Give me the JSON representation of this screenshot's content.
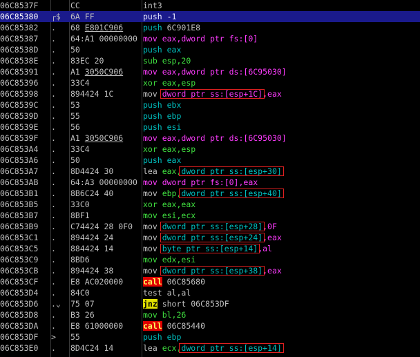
{
  "rows": [
    {
      "addr": "06C8537F",
      "mark": "",
      "hex": "CC",
      "hex_u": "",
      "hex_post": "",
      "asm": [
        {
          "m": "int3",
          "c": "t-m"
        }
      ]
    },
    {
      "addr": "06C85380",
      "mark": "┌$",
      "hex": "6A FF",
      "hex_u": "",
      "hex_post": "",
      "selected": true,
      "asm": [
        {
          "m": "push",
          "c": "t-m"
        },
        {
          "m": " -1",
          "c": "t-w"
        }
      ]
    },
    {
      "addr": "06C85382",
      "mark": ".",
      "hex": "68 ",
      "hex_u": "E801C906",
      "hex_post": "",
      "asm": [
        {
          "m": "push",
          "c": "t-mc"
        },
        {
          "m": " 6C901E8",
          "c": "t-w"
        }
      ]
    },
    {
      "addr": "06C85387",
      "mark": ".",
      "hex": "64:A1 00000000",
      "hex_u": "",
      "hex_post": "",
      "asm": [
        {
          "m": "mov",
          "c": "t-mp"
        },
        {
          "m": " eax,dword ptr fs:[0]",
          "c": "t-mp"
        }
      ]
    },
    {
      "addr": "06C8538D",
      "mark": ".",
      "hex": "50",
      "hex_u": "",
      "hex_post": "",
      "asm": [
        {
          "m": "push",
          "c": "t-mc"
        },
        {
          "m": " eax",
          "c": "t-mc"
        }
      ]
    },
    {
      "addr": "06C8538E",
      "mark": ".",
      "hex": "83EC 20",
      "hex_u": "",
      "hex_post": "",
      "asm": [
        {
          "m": "sub",
          "c": "t-mg"
        },
        {
          "m": " esp,20",
          "c": "t-mg"
        }
      ]
    },
    {
      "addr": "06C85391",
      "mark": ".",
      "hex": "A1 ",
      "hex_u": "3050C906",
      "hex_post": "",
      "asm": [
        {
          "m": "mov",
          "c": "t-mp"
        },
        {
          "m": " eax,dword ptr ds:[6C95030]",
          "c": "t-mp"
        }
      ]
    },
    {
      "addr": "06C85396",
      "mark": ".",
      "hex": "33C4",
      "hex_u": "",
      "hex_post": "",
      "asm": [
        {
          "m": "xor",
          "c": "t-mg"
        },
        {
          "m": " eax,esp",
          "c": "t-mg"
        }
      ]
    },
    {
      "addr": "06C85398",
      "mark": ".",
      "hex": "894424 1C",
      "hex_u": "",
      "hex_post": "",
      "asm": [
        {
          "m": "mov",
          "c": "t-w"
        },
        {
          "m": " dword ptr ss:[esp+1C]",
          "c": "t-mp"
        },
        {
          "m": ",eax",
          "c": "t-mp"
        }
      ]
    },
    {
      "addr": "06C8539C",
      "mark": ".",
      "hex": "53",
      "hex_u": "",
      "hex_post": "",
      "asm": [
        {
          "m": "push",
          "c": "t-mc"
        },
        {
          "m": " ebx",
          "c": "t-mc"
        }
      ]
    },
    {
      "addr": "06C8539D",
      "mark": ".",
      "hex": "55",
      "hex_u": "",
      "hex_post": "",
      "asm": [
        {
          "m": "push",
          "c": "t-mc"
        },
        {
          "m": " ebp",
          "c": "t-mc"
        }
      ]
    },
    {
      "addr": "06C8539E",
      "mark": ".",
      "hex": "56",
      "hex_u": "",
      "hex_post": "",
      "asm": [
        {
          "m": "push",
          "c": "t-mc"
        },
        {
          "m": " esi",
          "c": "t-mc"
        }
      ]
    },
    {
      "addr": "06C8539F",
      "mark": ".",
      "hex": "A1 ",
      "hex_u": "3050C906",
      "hex_post": "",
      "asm": [
        {
          "m": "mov",
          "c": "t-mp"
        },
        {
          "m": " eax,dword ptr ds:[6C95030]",
          "c": "t-mp"
        }
      ]
    },
    {
      "addr": "06C853A4",
      "mark": ".",
      "hex": "33C4",
      "hex_u": "",
      "hex_post": "",
      "asm": [
        {
          "m": "xor",
          "c": "t-mg"
        },
        {
          "m": " eax,esp",
          "c": "t-mg"
        }
      ]
    },
    {
      "addr": "06C853A6",
      "mark": ".",
      "hex": "50",
      "hex_u": "",
      "hex_post": "",
      "asm": [
        {
          "m": "push",
          "c": "t-mc"
        },
        {
          "m": " eax",
          "c": "t-mc"
        }
      ]
    },
    {
      "addr": "06C853A7",
      "mark": ".",
      "hex": "8D4424 30",
      "hex_u": "",
      "hex_post": "",
      "asm": [
        {
          "m": "lea",
          "c": "t-w"
        },
        {
          "m": " eax,",
          "c": "t-mg"
        },
        {
          "m": "dword ptr ss:[esp+30]",
          "c": "t-mc"
        }
      ]
    },
    {
      "addr": "06C853AB",
      "mark": ".",
      "hex": "64:A3 00000000",
      "hex_u": "",
      "hex_post": "",
      "asm": [
        {
          "m": "mov",
          "c": "t-mp"
        },
        {
          "m": " dword ptr fs:[0]",
          "c": "t-mp"
        },
        {
          "m": ",eax",
          "c": "t-mp"
        }
      ]
    },
    {
      "addr": "06C853B1",
      "mark": ".",
      "hex": "8B6C24 40",
      "hex_u": "",
      "hex_post": "",
      "asm": [
        {
          "m": "mov",
          "c": "t-w"
        },
        {
          "m": " ebp,",
          "c": "t-mg"
        },
        {
          "m": "dword ptr ss:[esp+40]",
          "c": "t-mc"
        }
      ]
    },
    {
      "addr": "06C853B5",
      "mark": ".",
      "hex": "33C0",
      "hex_u": "",
      "hex_post": "",
      "asm": [
        {
          "m": "xor",
          "c": "t-mg"
        },
        {
          "m": " eax,eax",
          "c": "t-mg"
        }
      ]
    },
    {
      "addr": "06C853B7",
      "mark": ".",
      "hex": "8BF1",
      "hex_u": "",
      "hex_post": "",
      "asm": [
        {
          "m": "mov",
          "c": "t-mg"
        },
        {
          "m": " esi,ecx",
          "c": "t-mg"
        }
      ]
    },
    {
      "addr": "06C853B9",
      "mark": ".",
      "hex": "C74424 28 0F0",
      "hex_u": "",
      "hex_post": "",
      "asm": [
        {
          "m": "mov",
          "c": "t-w"
        },
        {
          "m": " dword ptr ss:[esp+28]",
          "c": "t-mc"
        },
        {
          "m": ",0F",
          "c": "t-mp"
        }
      ]
    },
    {
      "addr": "06C853C1",
      "mark": ".",
      "hex": "894424 24",
      "hex_u": "",
      "hex_post": "",
      "asm": [
        {
          "m": "mov",
          "c": "t-w"
        },
        {
          "m": " dword ptr ss:[esp+24]",
          "c": "t-mc"
        },
        {
          "m": ",eax",
          "c": "t-mp"
        }
      ]
    },
    {
      "addr": "06C853C5",
      "mark": ".",
      "hex": "884424 14",
      "hex_u": "",
      "hex_post": "",
      "asm": [
        {
          "m": "mov",
          "c": "t-w"
        },
        {
          "m": " byte ptr ss:[esp+14]",
          "c": "t-mc"
        },
        {
          "m": ",al",
          "c": "t-mp"
        }
      ]
    },
    {
      "addr": "06C853C9",
      "mark": ".",
      "hex": "8BD6",
      "hex_u": "",
      "hex_post": "",
      "asm": [
        {
          "m": "mov",
          "c": "t-mg"
        },
        {
          "m": " edx,esi",
          "c": "t-mg"
        }
      ]
    },
    {
      "addr": "06C853CB",
      "mark": ".",
      "hex": "894424 38",
      "hex_u": "",
      "hex_post": "",
      "asm": [
        {
          "m": "mov",
          "c": "t-w"
        },
        {
          "m": " dword ptr ss:[esp+38]",
          "c": "t-mc"
        },
        {
          "m": ",eax",
          "c": "t-mp"
        }
      ]
    },
    {
      "addr": "06C853CF",
      "mark": ".",
      "hex": "E8 AC020000",
      "hex_u": "",
      "hex_post": "",
      "asm": [
        {
          "m": "call",
          "c": "t-call"
        },
        {
          "m": " 06C85680",
          "c": "t-w"
        }
      ]
    },
    {
      "addr": "06C853D4",
      "mark": ".",
      "hex": "84C0",
      "hex_u": "",
      "hex_post": "",
      "asm": [
        {
          "m": "test",
          "c": "t-w"
        },
        {
          "m": " al,al",
          "c": "t-w"
        }
      ]
    },
    {
      "addr": "06C853D6",
      "mark": ".⌄",
      "hex": "75 07",
      "hex_u": "",
      "hex_post": "",
      "asm": [
        {
          "m": "jnz",
          "c": "t-jmp"
        },
        {
          "m": " short 06C853DF",
          "c": "t-w"
        }
      ]
    },
    {
      "addr": "06C853D8",
      "mark": ".",
      "hex": "B3 26",
      "hex_u": "",
      "hex_post": "",
      "asm": [
        {
          "m": "mov",
          "c": "t-mg"
        },
        {
          "m": " bl,26",
          "c": "t-mg"
        }
      ]
    },
    {
      "addr": "06C853DA",
      "mark": ".",
      "hex": "E8 61000000",
      "hex_u": "",
      "hex_post": "",
      "asm": [
        {
          "m": "call",
          "c": "t-call"
        },
        {
          "m": " 06C85440",
          "c": "t-w"
        }
      ]
    },
    {
      "addr": "06C853DF",
      "mark": ">",
      "hex": "55",
      "hex_u": "",
      "hex_post": "",
      "asm": [
        {
          "m": "push",
          "c": "t-mc"
        },
        {
          "m": " ebp",
          "c": "t-mc"
        }
      ]
    },
    {
      "addr": "06C853E0",
      "mark": ".",
      "hex": "8D4C24 14",
      "hex_u": "",
      "hex_post": "",
      "asm": [
        {
          "m": "lea",
          "c": "t-w"
        },
        {
          "m": " ecx,",
          "c": "t-mg"
        },
        {
          "m": "dword ptr ss:[esp+14]",
          "c": "t-mc"
        }
      ]
    }
  ],
  "colors": {
    "background": "#000000",
    "selection": "#1a1a8c",
    "highlight_box": "#e02020",
    "magenta": "#ff3cff",
    "cyan": "#00c0c0",
    "green": "#40e040",
    "call_bg": "#e00000",
    "jump_bg": "#e0e000"
  }
}
